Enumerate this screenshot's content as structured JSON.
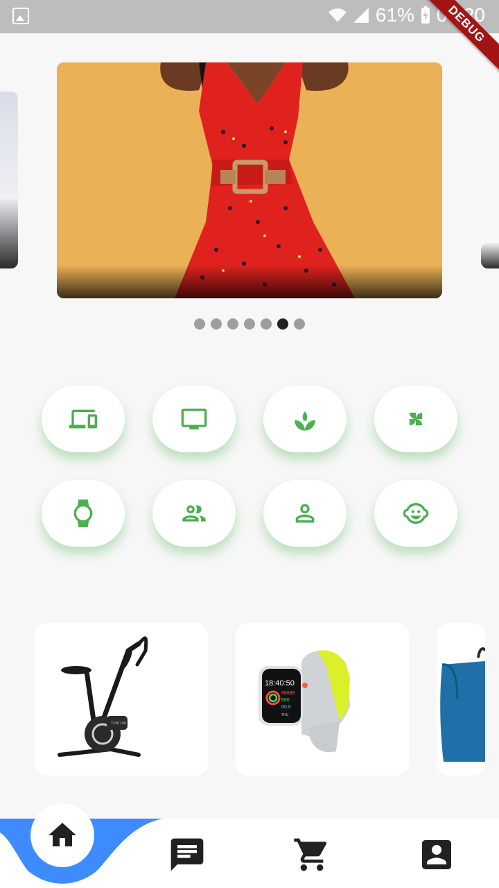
{
  "status_bar": {
    "battery": "61%",
    "time": "07:20",
    "icons": [
      "gallery-icon",
      "wifi-icon",
      "signal-icon",
      "battery-charging-icon"
    ]
  },
  "debug_banner": "DEBUG",
  "carousel": {
    "slide_count": 7,
    "active_index": 5
  },
  "categories": {
    "accent_color": "#4caf50",
    "items": [
      {
        "icon": "devices-icon"
      },
      {
        "icon": "monitor-icon"
      },
      {
        "icon": "plant-icon"
      },
      {
        "icon": "fan-icon"
      },
      {
        "icon": "watch-icon"
      },
      {
        "icon": "people-icon"
      },
      {
        "icon": "person-icon"
      },
      {
        "icon": "baby-face-icon"
      }
    ]
  },
  "watch_screen": {
    "time": "18:40:50",
    "steps": "88888",
    "cal": "666",
    "dist": "00.0",
    "day": "THU"
  },
  "bottom_nav": {
    "accent_color": "#3d8bfd",
    "items": [
      "home-icon",
      "chat-icon",
      "cart-icon",
      "account-icon"
    ]
  }
}
